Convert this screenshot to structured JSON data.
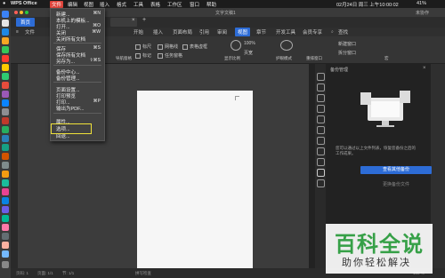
{
  "macbar": {
    "apple": "",
    "app_name": "WPS Office",
    "menus": [
      "文件",
      "编辑",
      "视图",
      "插入",
      "格式",
      "工具",
      "表格",
      "工作区",
      "窗口",
      "帮助"
    ],
    "clock": "02月24日 周三 上午10:00:02",
    "battery": "41%"
  },
  "window": {
    "title": "文字文稿1",
    "home_tab": "首页",
    "doc_tab": "文字文稿1",
    "collab": "未协作"
  },
  "ribbon": {
    "file_label": "文件",
    "tabs": [
      "开始",
      "插入",
      "页面布局",
      "引用",
      "审阅",
      "视图",
      "章节",
      "开发工具",
      "会员专享"
    ],
    "active_tab": "视图",
    "search": "查找",
    "options": [
      "标尺",
      "网格线",
      "表格虚框",
      "标记",
      "任务窗格"
    ],
    "groups": [
      "导航窗格",
      "显示比例",
      "100%",
      "页宽",
      "护眼模式",
      "重排窗口",
      "新建窗口",
      "拆分窗口",
      "宏"
    ],
    "nav_label": "导航窗格",
    "zoom_label": "显示比例",
    "zoom_value": "100%",
    "pagewidth_label": "页宽",
    "eye_label": "护眼模式",
    "reflow_label": "重排窗口",
    "newwin_label": "新建窗口",
    "split_label": "拆分窗口",
    "macro_label": "宏"
  },
  "file_menu": {
    "items": [
      {
        "label": "新建...",
        "shortcut": "⌘N"
      },
      {
        "label": "本机上的模板...",
        "shortcut": ""
      },
      {
        "label": "打开...",
        "shortcut": "⌘O"
      },
      {
        "label": "关闭",
        "shortcut": "⌘W"
      },
      {
        "label": "关闭所有文档",
        "shortcut": ""
      },
      {
        "label": "保存",
        "shortcut": "⌘S"
      },
      {
        "label": "保存所有文档",
        "shortcut": ""
      },
      {
        "label": "另存为...",
        "shortcut": "⇧⌘S"
      },
      {
        "label": "备份中心...",
        "shortcut": ""
      },
      {
        "label": "备份管理...",
        "shortcut": ""
      },
      {
        "label": "页面设置...",
        "shortcut": ""
      },
      {
        "label": "打印预览",
        "shortcut": ""
      },
      {
        "label": "打印...",
        "shortcut": "⌘P"
      },
      {
        "label": "输出为PDF...",
        "shortcut": ""
      },
      {
        "label": "属性...",
        "shortcut": ""
      },
      {
        "label": "选项...",
        "shortcut": ""
      },
      {
        "label": "回退...",
        "shortcut": ""
      }
    ]
  },
  "right_panel": {
    "title": "备份管理",
    "description": "您可以通过以上文件列表，恢复您备份之后的工作成果。",
    "primary_button": "查看其他备份",
    "secondary_button": "更换备份文件"
  },
  "status": {
    "page": "页码: 1",
    "pages": "页面: 1/1",
    "section": "节: 1/1",
    "spell": "拼写检查",
    "zoom": "100 %"
  },
  "watermark": {
    "logo": "百科全说",
    "sub": "助你轻松解决"
  },
  "colors": {
    "accent": "#2d6cd6",
    "menu_highlight": "#e0453c",
    "focus_box": "#f0e23a",
    "brand_green": "#36a047"
  }
}
